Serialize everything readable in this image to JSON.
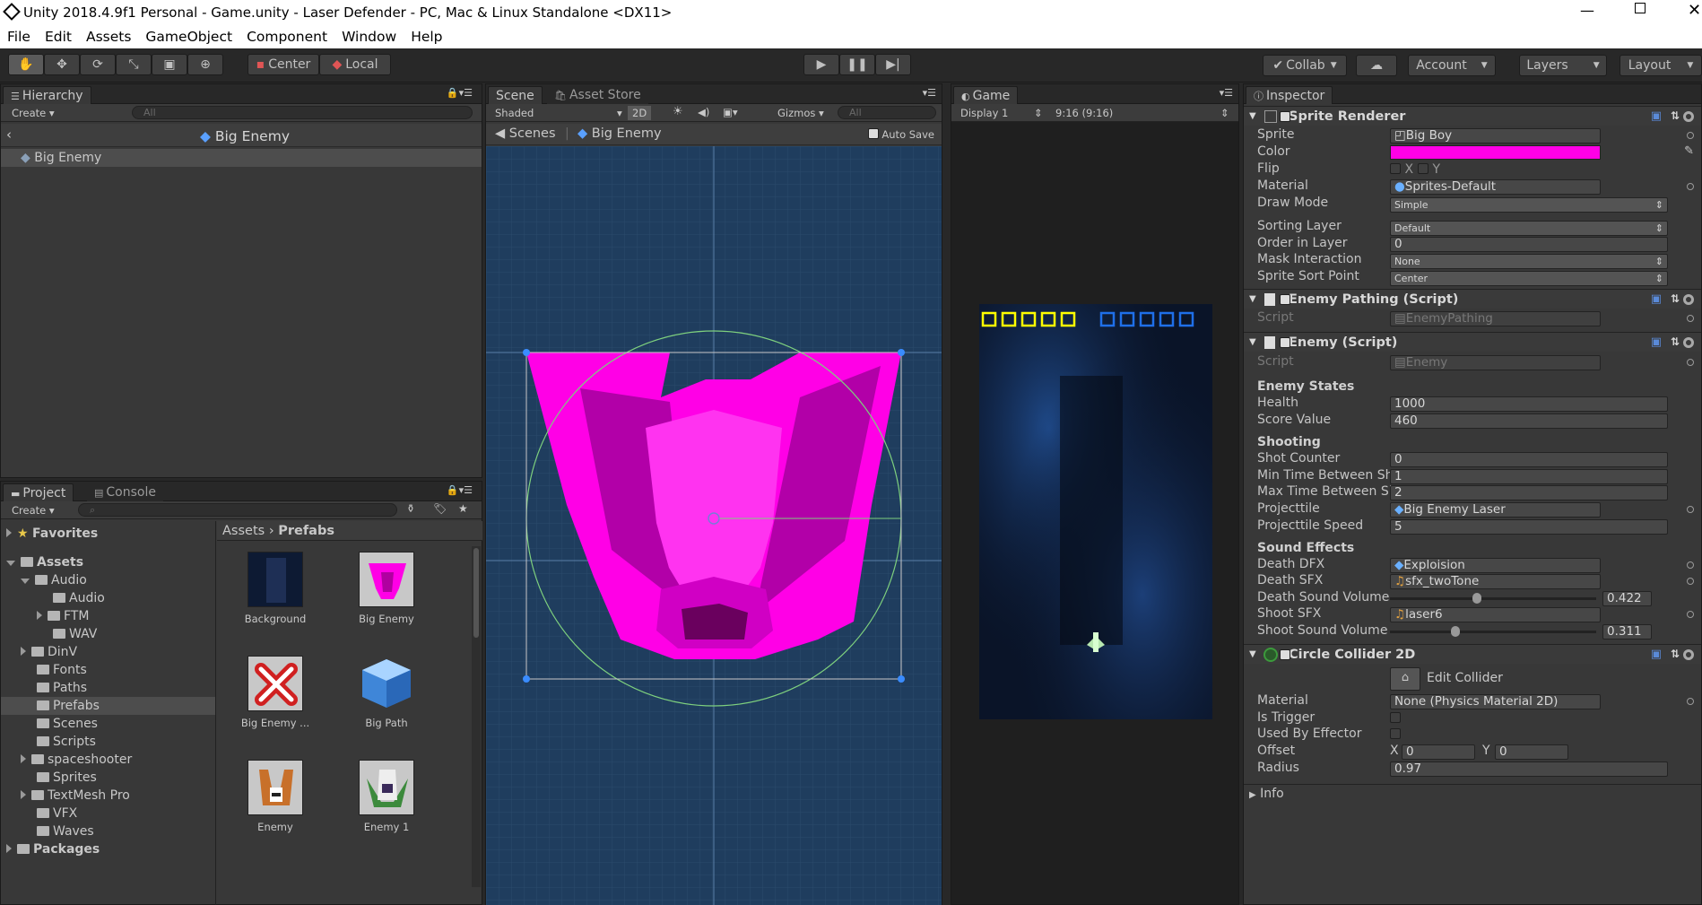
{
  "window": {
    "title": "Unity 2018.4.9f1 Personal - Game.unity - Laser Defender - PC, Mac & Linux Standalone <DX11>"
  },
  "menu": [
    "File",
    "Edit",
    "Assets",
    "GameObject",
    "Component",
    "Window",
    "Help"
  ],
  "toolbar": {
    "pivot": "Center",
    "space": "Local",
    "collab": "Collab",
    "account": "Account",
    "layers": "Layers",
    "layout": "Layout"
  },
  "hierarchy": {
    "tab": "Hierarchy",
    "create": "Create",
    "search_placeholder": "All",
    "header": "Big Enemy",
    "items": [
      "Big Enemy"
    ]
  },
  "scene": {
    "tab": "Scene",
    "tab2": "Asset Store",
    "shading": "Shaded",
    "mode2d": "2D",
    "gizmos": "Gizmos",
    "search_placeholder": "All",
    "crumb_root": "Scenes",
    "crumb_item": "Big Enemy",
    "autosave": "Auto Save"
  },
  "game": {
    "tab": "Game",
    "display": "Display 1",
    "aspect": "9:16 (9:16)",
    "lives_player": 5,
    "lives_enemy": 5
  },
  "project": {
    "tab": "Project",
    "tab2": "Console",
    "create": "Create",
    "favorites": "Favorites",
    "assets": "Assets",
    "packages": "Packages",
    "tree": [
      "Audio",
      "Audio",
      "FTM",
      "WAV",
      "DinV",
      "Fonts",
      "Paths",
      "Prefabs",
      "Scenes",
      "Scripts",
      "spaceshooter",
      "Sprites",
      "TextMesh Pro",
      "VFX",
      "Waves"
    ],
    "breadcrumb": [
      "Assets",
      "Prefabs"
    ],
    "assets_grid": [
      "Background",
      "Big Enemy",
      "Big Enemy ...",
      "Big Path",
      "Enemy",
      "Enemy 1"
    ]
  },
  "inspector": {
    "tab": "Inspector",
    "sprite_renderer": {
      "title": "Sprite Renderer",
      "labels": [
        "Sprite",
        "Color",
        "Flip",
        "Material",
        "Draw Mode",
        "Sorting Layer",
        "Order in Layer",
        "Mask Interaction",
        "Sprite Sort Point"
      ],
      "sprite": "Big Boy",
      "color": "#ff00e6",
      "flip_x": "X",
      "flip_y": "Y",
      "material": "Sprites-Default",
      "draw_mode": "Simple",
      "sorting_layer": "Default",
      "order": "0",
      "mask": "None",
      "sort_point": "Center"
    },
    "enemy_pathing": {
      "title": "Enemy Pathing (Script)",
      "script_label": "Script",
      "script": "EnemyPathing"
    },
    "enemy": {
      "title": "Enemy (Script)",
      "script_label": "Script",
      "script": "Enemy",
      "states_header": "Enemy States",
      "health_label": "Health",
      "health": "1000",
      "score_label": "Score Value",
      "score": "460",
      "shooting_header": "Shooting",
      "shot_counter_label": "Shot Counter",
      "shot_counter": "0",
      "min_label": "Min Time Between Shots",
      "min": "1",
      "max_label": "Max Time Between Shot",
      "max": "2",
      "projectile_label": "Projecttile",
      "projectile": "Big Enemy Laser",
      "proj_speed_label": "Projecttile Speed",
      "proj_speed": "5",
      "sfx_header": "Sound Effects",
      "death_dfx_label": "Death DFX",
      "death_dfx": "Exploision",
      "death_sfx_label": "Death SFX",
      "death_sfx": "sfx_twoTone",
      "death_vol_label": "Death Sound Volume",
      "death_vol": "0.422",
      "shoot_sfx_label": "Shoot SFX",
      "shoot_sfx": "laser6",
      "shoot_vol_label": "Shoot Sound Volume",
      "shoot_vol": "0.311"
    },
    "collider": {
      "title": "Circle Collider 2D",
      "edit": "Edit Collider",
      "material_label": "Material",
      "material": "None (Physics Material 2D)",
      "trigger_label": "Is Trigger",
      "effector_label": "Used By Effector",
      "offset_label": "Offset",
      "x_label": "X",
      "x": "0",
      "y_label": "Y",
      "y": "0",
      "radius_label": "Radius",
      "radius": "0.97"
    },
    "info": "Info"
  },
  "colors": {
    "accent": "#ff00e6",
    "scene_bg": "#1f3d5e",
    "selection": "#4d4d4d"
  }
}
